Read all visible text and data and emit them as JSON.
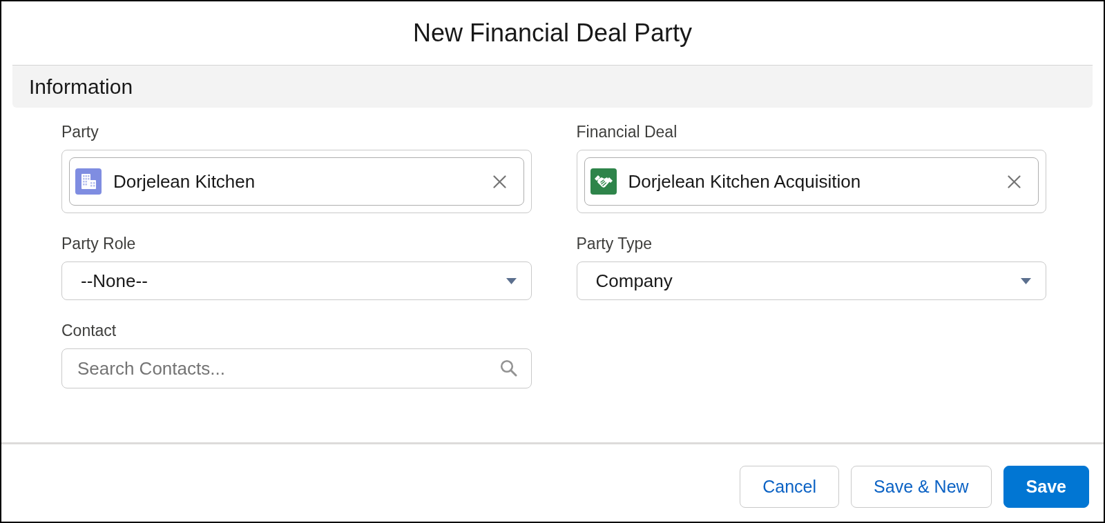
{
  "modal": {
    "title": "New Financial Deal Party"
  },
  "section": {
    "title": "Information"
  },
  "fields": [
    {
      "kind": "lookup",
      "label": "Party",
      "value": "Dorjelean Kitchen",
      "color": "#7f8de1"
    },
    {
      "kind": "lookup",
      "label": "Financial Deal",
      "value": "Dorjelean Kitchen Acquisition",
      "color": "#2e844a"
    },
    {
      "kind": "picklist",
      "label": "Party Role",
      "value": "--None--"
    },
    {
      "kind": "picklist",
      "label": "Party Type",
      "value": "Company"
    },
    {
      "kind": "search",
      "label": "Contact",
      "placeholder": "Search Contacts..."
    }
  ],
  "footer": {
    "buttons": [
      {
        "kind": "neutral",
        "label": "Cancel"
      },
      {
        "kind": "neutral",
        "label": "Save & New"
      },
      {
        "kind": "brand",
        "label": "Save"
      }
    ]
  }
}
